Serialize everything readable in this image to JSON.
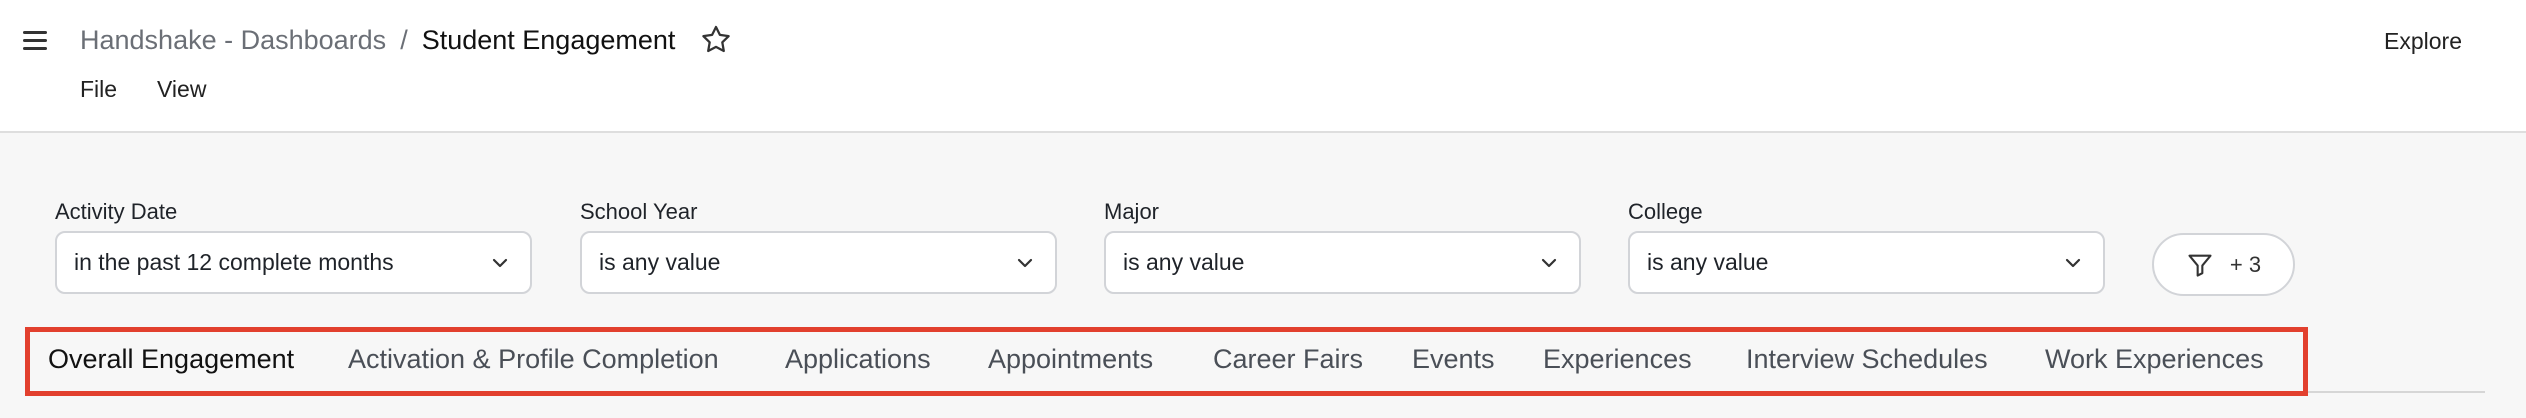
{
  "header": {
    "breadcrumb_parent": "Handshake - Dashboards",
    "breadcrumb_separator": "/",
    "title": "Student Engagement",
    "menus": [
      "File",
      "View"
    ],
    "explore_label": "Explore"
  },
  "filters": [
    {
      "label": "Activity Date",
      "value": "in the past 12 complete months"
    },
    {
      "label": "School Year",
      "value": "is any value"
    },
    {
      "label": "Major",
      "value": "is any value"
    },
    {
      "label": "College",
      "value": "is any value"
    }
  ],
  "more_filters_label": "+ 3",
  "tabs": [
    {
      "label": "Overall Engagement",
      "active": true
    },
    {
      "label": "Activation & Profile Completion",
      "active": false
    },
    {
      "label": "Applications",
      "active": false
    },
    {
      "label": "Appointments",
      "active": false
    },
    {
      "label": "Career Fairs",
      "active": false
    },
    {
      "label": "Events",
      "active": false
    },
    {
      "label": "Experiences",
      "active": false
    },
    {
      "label": "Interview Schedules",
      "active": false
    },
    {
      "label": "Work Experiences",
      "active": false
    }
  ],
  "colors": {
    "highlight": "#e2402e",
    "background": "#f7f7f7"
  },
  "icons": [
    "menu-icon",
    "star-icon",
    "chevron-down-icon",
    "filter-icon"
  ]
}
